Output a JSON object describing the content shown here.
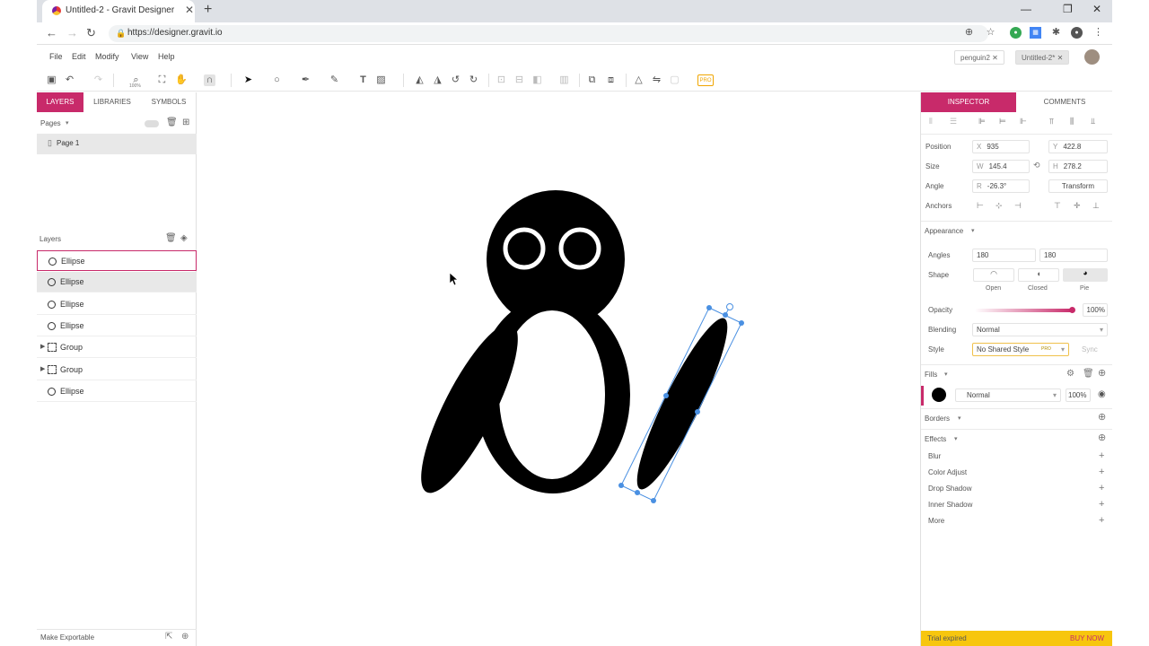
{
  "browser": {
    "tab_title": "Untitled-2 - Gravit Designer",
    "tab_close": "✕",
    "new_tab": "+",
    "url": "https://designer.gravit.io",
    "win_min": "—",
    "win_restore": "❐",
    "win_close": "✕"
  },
  "menu": {
    "file": "File",
    "edit": "Edit",
    "modify": "Modify",
    "view": "View",
    "help": "Help"
  },
  "doc_tabs": [
    "penguin2",
    "Untitled-2*"
  ],
  "toolbar": {
    "zoom_label": "100%",
    "pro_badge": "PRO"
  },
  "left_panel": {
    "tabs": [
      "LAYERS",
      "LIBRARIES",
      "SYMBOLS"
    ],
    "pages_label": "Pages",
    "page_items": [
      "Page 1"
    ],
    "layers_label": "Layers",
    "layers": [
      {
        "type": "ellipse",
        "label": "Ellipse"
      },
      {
        "type": "ellipse",
        "label": "Ellipse"
      },
      {
        "type": "ellipse",
        "label": "Ellipse"
      },
      {
        "type": "ellipse",
        "label": "Ellipse"
      },
      {
        "type": "group",
        "label": "Group"
      },
      {
        "type": "group",
        "label": "Group"
      },
      {
        "type": "ellipse",
        "label": "Ellipse"
      }
    ],
    "export_label": "Make Exportable"
  },
  "inspector": {
    "tabs": [
      "INSPECTOR",
      "COMMENTS"
    ],
    "position_label": "Position",
    "x_prefix": "X",
    "x_value": "935",
    "y_prefix": "Y",
    "y_value": "422.8",
    "size_label": "Size",
    "w_prefix": "W",
    "w_value": "145.4",
    "h_prefix": "H",
    "h_value": "278.2",
    "angle_label": "Angle",
    "r_prefix": "R",
    "r_value": "-26.3°",
    "transform_label": "Transform",
    "anchors_label": "Anchors",
    "appearance_label": "Appearance",
    "angles_label": "Angles",
    "angle_start": "180",
    "angle_end": "180",
    "shape_label": "Shape",
    "shape_options": [
      "Open",
      "Closed",
      "Pie"
    ],
    "opacity_label": "Opacity",
    "opacity_value": "100%",
    "blending_label": "Blending",
    "blending_value": "Normal",
    "style_label": "Style",
    "style_value": "No Shared Style",
    "style_badge": "PRO",
    "sync_label": "Sync",
    "fills_label": "Fills",
    "fill_blend": "Normal",
    "fill_opacity": "100%",
    "borders_label": "Borders",
    "effects_label": "Effects",
    "effects": [
      "Blur",
      "Color Adjust",
      "Drop Shadow",
      "Inner Shadow",
      "More"
    ],
    "trial_text": "Trial expired",
    "buy_text": "BUY NOW"
  },
  "colors": {
    "accent": "#c82a6a",
    "selection": "#4a90e2",
    "trial_bar": "#f7c60e"
  },
  "icons": [
    "save-icon",
    "undo-icon",
    "redo-icon",
    "zoom-icon",
    "hand-icon",
    "magnet-icon",
    "pointer-icon",
    "ellipse-tool-icon",
    "pen-tool-icon",
    "brush-tool-icon",
    "text-tool-icon",
    "image-tool-icon",
    "trash-icon",
    "add-layer-icon",
    "settings-icon",
    "eye-icon",
    "plus-icon"
  ]
}
